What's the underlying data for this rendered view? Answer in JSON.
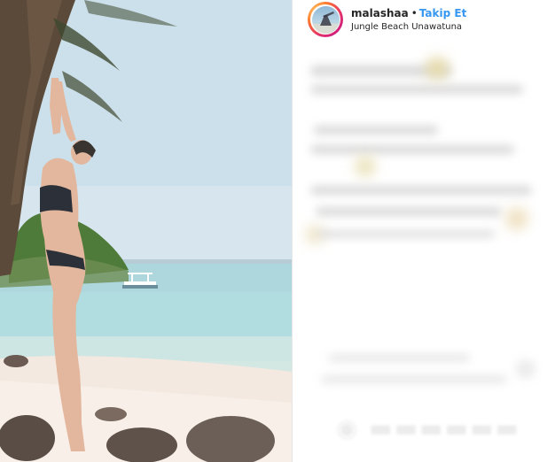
{
  "post": {
    "username": "malashaa",
    "separator": "•",
    "follow_label": "Takip Et",
    "location": "Jungle Beach Unawatuna"
  },
  "colors": {
    "follow": "#3897f0",
    "text": "#262626"
  },
  "icons": {
    "avatar": "profile-avatar-ring"
  }
}
